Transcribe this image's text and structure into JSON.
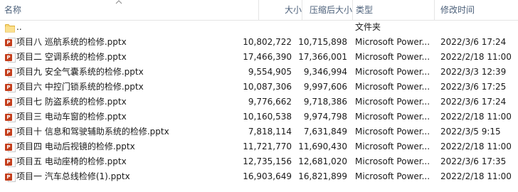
{
  "columns": {
    "name": "名称",
    "size": "大小",
    "compressed": "压缩后大小",
    "type": "类型",
    "modified": "修改时间"
  },
  "parent": {
    "name": "..",
    "type": "文件夹"
  },
  "files": [
    {
      "name": "项目八 巡航系统的检修.pptx",
      "size": "10,802,722",
      "compressed": "10,715,898",
      "type": "Microsoft Power...",
      "modified": "2022/3/6 17:24"
    },
    {
      "name": "项目二 空调系统的检修.pptx",
      "size": "17,466,390",
      "compressed": "17,366,001",
      "type": "Microsoft Power...",
      "modified": "2022/2/18 11:00"
    },
    {
      "name": "项目九 安全气囊系统的检修.pptx",
      "size": "9,554,905",
      "compressed": "9,346,994",
      "type": "Microsoft Power...",
      "modified": "2022/3/3 12:39"
    },
    {
      "name": "项目六 中控门锁系统的检修.pptx",
      "size": "10,087,306",
      "compressed": "9,997,606",
      "type": "Microsoft Power...",
      "modified": "2022/3/6 17:25"
    },
    {
      "name": "项目七 防盗系统的检修.pptx",
      "size": "9,776,662",
      "compressed": "9,718,386",
      "type": "Microsoft Power...",
      "modified": "2022/3/6 17:24"
    },
    {
      "name": "项目三 电动车窗的检修.pptx",
      "size": "10,160,538",
      "compressed": "9,974,798",
      "type": "Microsoft Power...",
      "modified": "2022/2/18 11:00"
    },
    {
      "name": "项目十 信息和驾驶辅助系统的检修.pptx",
      "size": "7,818,114",
      "compressed": "7,631,849",
      "type": "Microsoft Power...",
      "modified": "2022/3/5 9:15"
    },
    {
      "name": "项目四 电动后视镜的检修.pptx",
      "size": "11,721,770",
      "compressed": "11,690,430",
      "type": "Microsoft Power...",
      "modified": "2022/2/18 11:00"
    },
    {
      "name": "项目五 电动座椅的检修.pptx",
      "size": "12,735,156",
      "compressed": "12,681,020",
      "type": "Microsoft Power...",
      "modified": "2022/3/6 17:35"
    },
    {
      "name": "项目一 汽车总线检修(1).pptx",
      "size": "16,903,649",
      "compressed": "16,821,899",
      "type": "Microsoft Power...",
      "modified": "2022/2/18 11:00"
    }
  ],
  "icons": {
    "file": "powerpoint-file-icon",
    "folder": "folder-icon",
    "sort": "sort-caret-icon"
  },
  "colors": {
    "ppt": "#c43e1c",
    "folder": "#f8d775",
    "header_text": "#4c607a"
  }
}
